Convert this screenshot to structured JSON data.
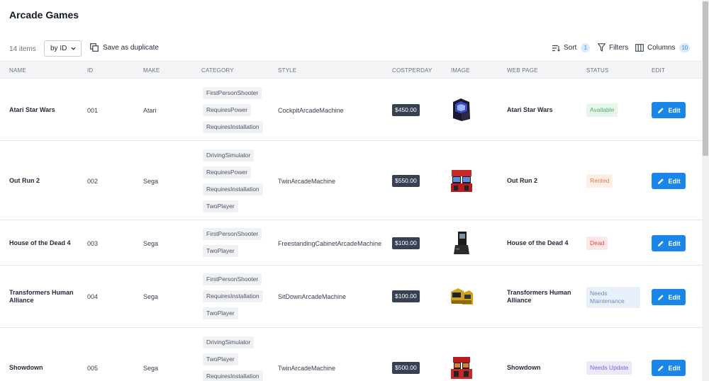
{
  "title": "Arcade Games",
  "toolbar": {
    "item_count": "14 items",
    "sort_select": "by ID",
    "duplicate_label": "Save as duplicate",
    "sort_label": "Sort",
    "sort_count": "1",
    "filters_label": "Filters",
    "columns_label": "Columns",
    "columns_count": "10"
  },
  "columns": [
    "NAME",
    "ID",
    "MAKE",
    "CATEGORY",
    "STYLE",
    "COSTPERDAY",
    "IMAGE",
    "WEB PAGE",
    "STATUS",
    "EDIT"
  ],
  "rows": [
    {
      "name": "Atari Star Wars",
      "id": "001",
      "make": "Atari",
      "categories": [
        "FirstPersonShooter",
        "RequiresPower",
        "RequiresInstallation"
      ],
      "style": "CockpitArcadeMachine",
      "cost": "$450.00",
      "image": "arcade-cabinet-icon",
      "web_page": "Atari Star Wars",
      "status": "Available",
      "edit": "Edit"
    },
    {
      "name": "Out Run 2",
      "id": "002",
      "make": "Sega",
      "categories": [
        "DrivingSimulator",
        "RequiresPower",
        "RequiresInstallation",
        "TwoPlayer"
      ],
      "style": "TwinArcadeMachine",
      "cost": "$550.00",
      "image": "twin-racing-cabinet-icon",
      "web_page": "Out Run 2",
      "status": "Rented",
      "edit": "Edit"
    },
    {
      "name": "House of the Dead 4",
      "id": "003",
      "make": "Sega",
      "categories": [
        "FirstPersonShooter",
        "TwoPlayer"
      ],
      "style": "FreestandingCabinetArcadeMachine",
      "cost": "$100.00",
      "image": "upright-cabinet-icon",
      "web_page": "House of the Dead 4",
      "status": "Dead",
      "edit": "Edit"
    },
    {
      "name": "Transformers Human Alliance",
      "id": "004",
      "make": "Sega",
      "categories": [
        "FirstPersonShooter",
        "RequiresInstallation",
        "TwoPlayer"
      ],
      "style": "SitDownArcadeMachine",
      "cost": "$100.00",
      "image": "sitdown-cabinet-icon",
      "web_page": "Transformers Human Alliance",
      "status": "Needs Maintenance",
      "edit": "Edit"
    },
    {
      "name": "Showdown",
      "id": "005",
      "make": "Sega",
      "categories": [
        "DrivingSimulator",
        "TwoPlayer",
        "RequiresInstallation"
      ],
      "style": "TwinArcadeMachine",
      "cost": "$500.00",
      "image": "twin-racing-cabinet-icon",
      "web_page": "Showdown",
      "status": "Needs Update",
      "edit": "Edit"
    }
  ],
  "status_colors": {
    "Available": {
      "bg": "#e7f6ea",
      "fg": "#4caf6a"
    },
    "Rented": {
      "bg": "#fdeee6",
      "fg": "#e07b4a"
    },
    "Dead": {
      "bg": "#fde6e6",
      "fg": "#d94848"
    },
    "Needs Maintenance": {
      "bg": "#e8f1fa",
      "fg": "#6d8fb3"
    },
    "Needs Update": {
      "bg": "#ece9fb",
      "fg": "#7a6ad6"
    }
  },
  "accent": "#1a86e8"
}
